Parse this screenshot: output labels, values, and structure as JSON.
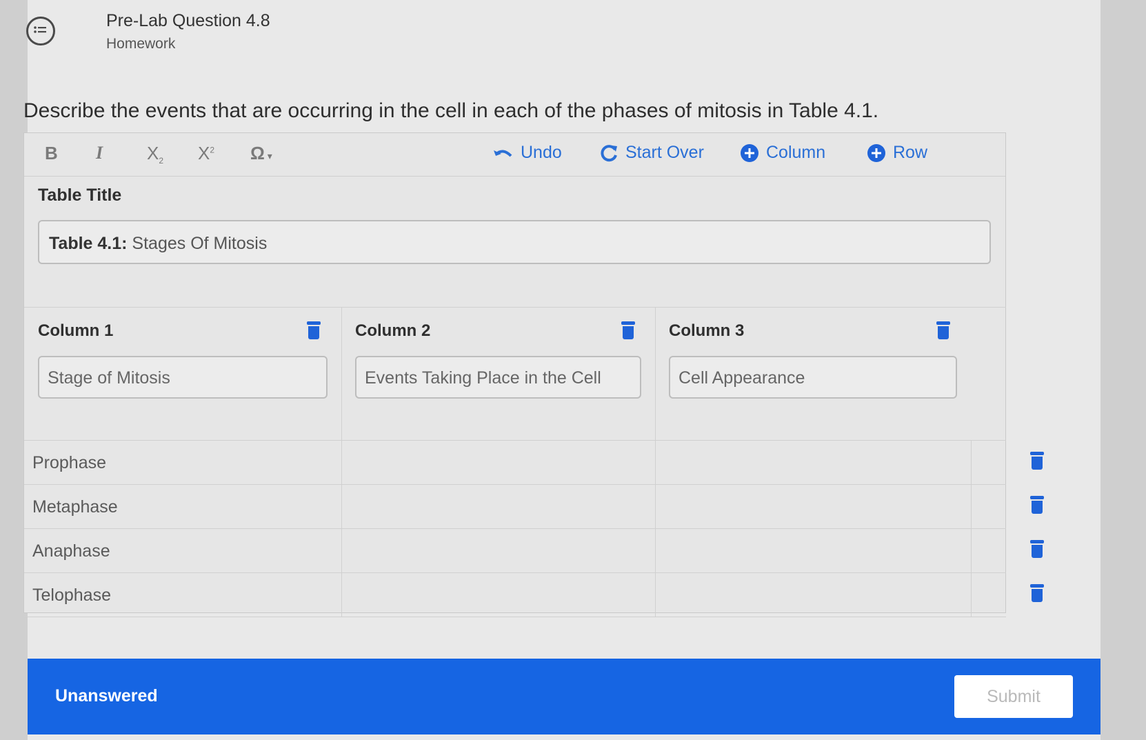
{
  "header": {
    "title": "Pre-Lab Question 4.8",
    "subtitle": "Homework"
  },
  "question": "Describe the events that are occurring in the cell in each of the phases of mitosis in Table 4.1.",
  "toolbar": {
    "bold": "B",
    "italic": "I",
    "subscript": "X",
    "superscript": "X",
    "special_char": "Ω",
    "undo": "Undo",
    "start_over": "Start Over",
    "add_column": "Column",
    "add_row": "Row"
  },
  "table_title": {
    "label": "Table Title",
    "prefix": "Table 4.1:",
    "value": "Stages Of Mitosis"
  },
  "columns": [
    {
      "label": "Column 1",
      "value": "Stage of Mitosis"
    },
    {
      "label": "Column 2",
      "value": "Events Taking Place in the Cell"
    },
    {
      "label": "Column 3",
      "value": "Cell Appearance"
    }
  ],
  "rows": [
    {
      "cells": [
        "Prophase",
        "",
        ""
      ]
    },
    {
      "cells": [
        "Metaphase",
        "",
        ""
      ]
    },
    {
      "cells": [
        "Anaphase",
        "",
        ""
      ]
    },
    {
      "cells": [
        "Telophase",
        "",
        ""
      ]
    }
  ],
  "footer": {
    "status": "Unanswered",
    "submit_label": "Submit"
  },
  "colors": {
    "accent": "#1f63d8",
    "footer_bar": "#1665e3"
  }
}
